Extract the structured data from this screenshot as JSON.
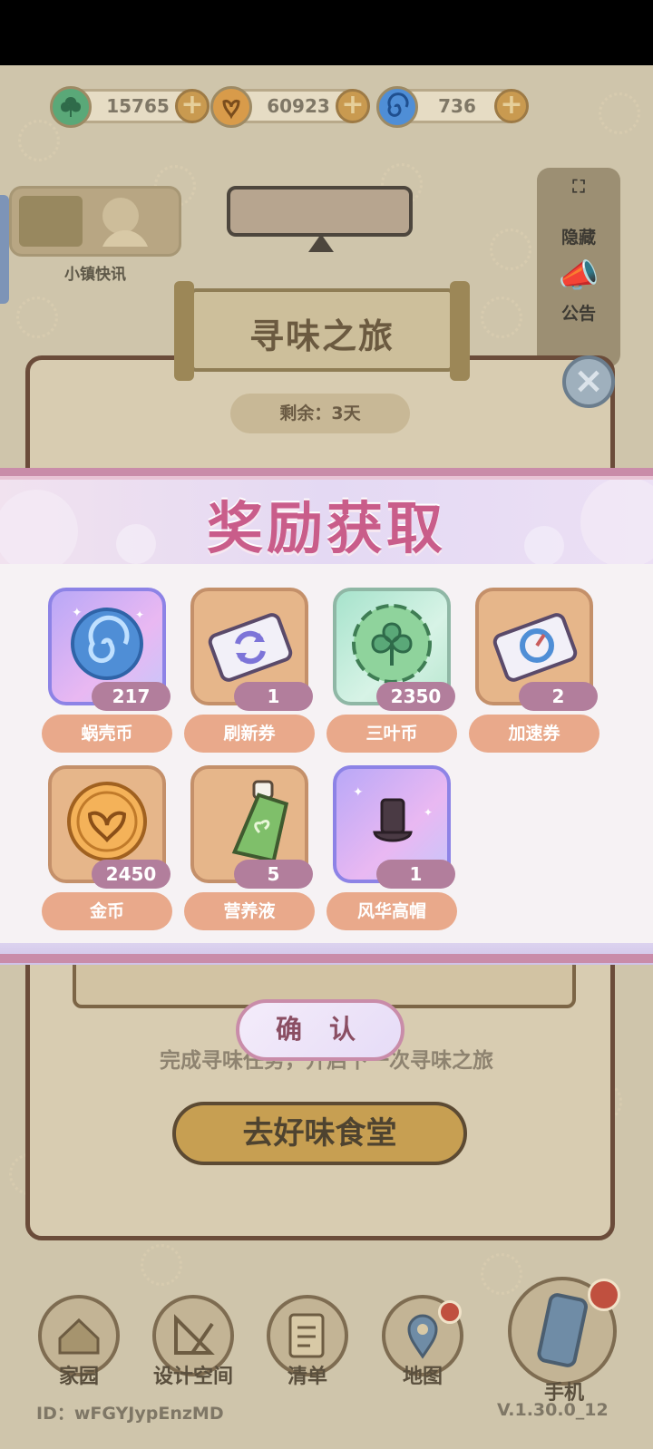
{
  "currencies": [
    {
      "name": "三叶币",
      "value": "15765",
      "icon": "clover-coin-icon",
      "color": "#5aa878"
    },
    {
      "name": "金币",
      "value": "60923",
      "icon": "gold-coin-icon",
      "color": "#d89b4a"
    },
    {
      "name": "蜗壳币",
      "value": "736",
      "icon": "snail-shell-icon",
      "color": "#4f8ed6"
    }
  ],
  "plus_symbol": "+",
  "news": {
    "label": "小镇快讯"
  },
  "right_panel": {
    "hide_label": "隐藏",
    "notice_label": "公告"
  },
  "journey": {
    "title": "寻味之旅",
    "remaining": "剩余：3天",
    "complete_text": "完成寻味任务，开启下一次寻味之旅",
    "go_button": "去好味食堂"
  },
  "reward_popup": {
    "title": "奖励获取",
    "confirm": "确 认",
    "items": [
      {
        "name": "蜗壳币",
        "count": "217",
        "style": "purple",
        "icon": "snail-shell-icon"
      },
      {
        "name": "刷新券",
        "count": "1",
        "style": "orange",
        "icon": "refresh-ticket-icon"
      },
      {
        "name": "三叶币",
        "count": "2350",
        "style": "green",
        "icon": "clover-coin-icon"
      },
      {
        "name": "加速券",
        "count": "2",
        "style": "orange",
        "icon": "speed-ticket-icon"
      },
      {
        "name": "金币",
        "count": "2450",
        "style": "orange",
        "icon": "gold-coin-icon"
      },
      {
        "name": "营养液",
        "count": "5",
        "style": "orange",
        "icon": "nutrient-bottle-icon"
      },
      {
        "name": "风华高帽",
        "count": "1",
        "style": "purple",
        "icon": "top-hat-icon"
      }
    ]
  },
  "bottom_nav": [
    {
      "label": "家园",
      "icon": "home-icon"
    },
    {
      "label": "设计空间",
      "icon": "design-icon"
    },
    {
      "label": "清单",
      "icon": "list-icon"
    },
    {
      "label": "地图",
      "icon": "map-pin-icon"
    },
    {
      "label": "手机",
      "icon": "phone-icon"
    }
  ],
  "footer": {
    "uid": "ID：wFGYJypEnzMD",
    "version": "V.1.30.0_12"
  }
}
